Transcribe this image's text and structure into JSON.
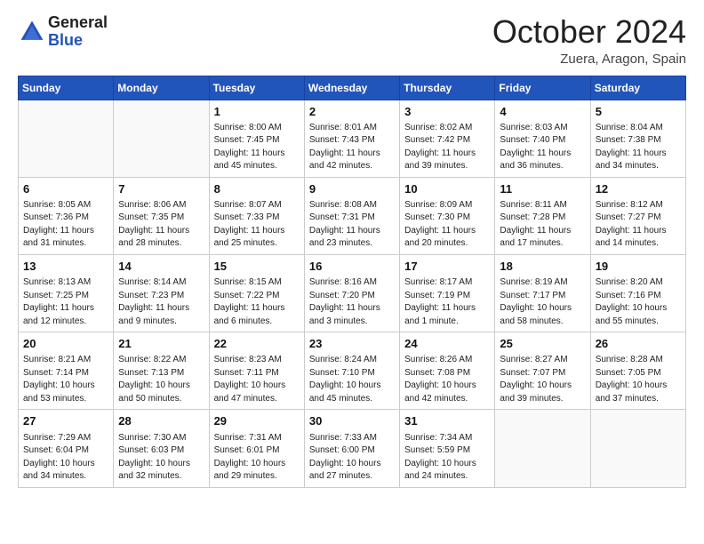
{
  "logo": {
    "general": "General",
    "blue": "Blue"
  },
  "title": {
    "month": "October 2024",
    "location": "Zuera, Aragon, Spain"
  },
  "headers": [
    "Sunday",
    "Monday",
    "Tuesday",
    "Wednesday",
    "Thursday",
    "Friday",
    "Saturday"
  ],
  "weeks": [
    [
      {
        "day": "",
        "info": ""
      },
      {
        "day": "",
        "info": ""
      },
      {
        "day": "1",
        "info": "Sunrise: 8:00 AM\nSunset: 7:45 PM\nDaylight: 11 hours and 45 minutes."
      },
      {
        "day": "2",
        "info": "Sunrise: 8:01 AM\nSunset: 7:43 PM\nDaylight: 11 hours and 42 minutes."
      },
      {
        "day": "3",
        "info": "Sunrise: 8:02 AM\nSunset: 7:42 PM\nDaylight: 11 hours and 39 minutes."
      },
      {
        "day": "4",
        "info": "Sunrise: 8:03 AM\nSunset: 7:40 PM\nDaylight: 11 hours and 36 minutes."
      },
      {
        "day": "5",
        "info": "Sunrise: 8:04 AM\nSunset: 7:38 PM\nDaylight: 11 hours and 34 minutes."
      }
    ],
    [
      {
        "day": "6",
        "info": "Sunrise: 8:05 AM\nSunset: 7:36 PM\nDaylight: 11 hours and 31 minutes."
      },
      {
        "day": "7",
        "info": "Sunrise: 8:06 AM\nSunset: 7:35 PM\nDaylight: 11 hours and 28 minutes."
      },
      {
        "day": "8",
        "info": "Sunrise: 8:07 AM\nSunset: 7:33 PM\nDaylight: 11 hours and 25 minutes."
      },
      {
        "day": "9",
        "info": "Sunrise: 8:08 AM\nSunset: 7:31 PM\nDaylight: 11 hours and 23 minutes."
      },
      {
        "day": "10",
        "info": "Sunrise: 8:09 AM\nSunset: 7:30 PM\nDaylight: 11 hours and 20 minutes."
      },
      {
        "day": "11",
        "info": "Sunrise: 8:11 AM\nSunset: 7:28 PM\nDaylight: 11 hours and 17 minutes."
      },
      {
        "day": "12",
        "info": "Sunrise: 8:12 AM\nSunset: 7:27 PM\nDaylight: 11 hours and 14 minutes."
      }
    ],
    [
      {
        "day": "13",
        "info": "Sunrise: 8:13 AM\nSunset: 7:25 PM\nDaylight: 11 hours and 12 minutes."
      },
      {
        "day": "14",
        "info": "Sunrise: 8:14 AM\nSunset: 7:23 PM\nDaylight: 11 hours and 9 minutes."
      },
      {
        "day": "15",
        "info": "Sunrise: 8:15 AM\nSunset: 7:22 PM\nDaylight: 11 hours and 6 minutes."
      },
      {
        "day": "16",
        "info": "Sunrise: 8:16 AM\nSunset: 7:20 PM\nDaylight: 11 hours and 3 minutes."
      },
      {
        "day": "17",
        "info": "Sunrise: 8:17 AM\nSunset: 7:19 PM\nDaylight: 11 hours and 1 minute."
      },
      {
        "day": "18",
        "info": "Sunrise: 8:19 AM\nSunset: 7:17 PM\nDaylight: 10 hours and 58 minutes."
      },
      {
        "day": "19",
        "info": "Sunrise: 8:20 AM\nSunset: 7:16 PM\nDaylight: 10 hours and 55 minutes."
      }
    ],
    [
      {
        "day": "20",
        "info": "Sunrise: 8:21 AM\nSunset: 7:14 PM\nDaylight: 10 hours and 53 minutes."
      },
      {
        "day": "21",
        "info": "Sunrise: 8:22 AM\nSunset: 7:13 PM\nDaylight: 10 hours and 50 minutes."
      },
      {
        "day": "22",
        "info": "Sunrise: 8:23 AM\nSunset: 7:11 PM\nDaylight: 10 hours and 47 minutes."
      },
      {
        "day": "23",
        "info": "Sunrise: 8:24 AM\nSunset: 7:10 PM\nDaylight: 10 hours and 45 minutes."
      },
      {
        "day": "24",
        "info": "Sunrise: 8:26 AM\nSunset: 7:08 PM\nDaylight: 10 hours and 42 minutes."
      },
      {
        "day": "25",
        "info": "Sunrise: 8:27 AM\nSunset: 7:07 PM\nDaylight: 10 hours and 39 minutes."
      },
      {
        "day": "26",
        "info": "Sunrise: 8:28 AM\nSunset: 7:05 PM\nDaylight: 10 hours and 37 minutes."
      }
    ],
    [
      {
        "day": "27",
        "info": "Sunrise: 7:29 AM\nSunset: 6:04 PM\nDaylight: 10 hours and 34 minutes."
      },
      {
        "day": "28",
        "info": "Sunrise: 7:30 AM\nSunset: 6:03 PM\nDaylight: 10 hours and 32 minutes."
      },
      {
        "day": "29",
        "info": "Sunrise: 7:31 AM\nSunset: 6:01 PM\nDaylight: 10 hours and 29 minutes."
      },
      {
        "day": "30",
        "info": "Sunrise: 7:33 AM\nSunset: 6:00 PM\nDaylight: 10 hours and 27 minutes."
      },
      {
        "day": "31",
        "info": "Sunrise: 7:34 AM\nSunset: 5:59 PM\nDaylight: 10 hours and 24 minutes."
      },
      {
        "day": "",
        "info": ""
      },
      {
        "day": "",
        "info": ""
      }
    ]
  ]
}
